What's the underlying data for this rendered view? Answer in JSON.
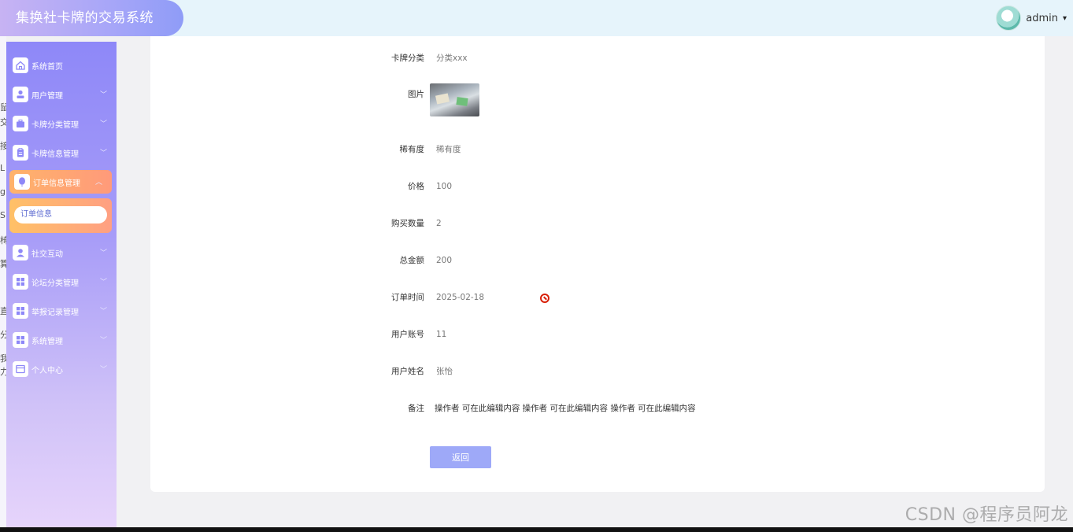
{
  "header": {
    "app_title": "集换社卡牌的交易系统",
    "user_name": "admin",
    "caret": "▾"
  },
  "edge_glyphs": [
    "鼠",
    "交",
    "接",
    "L",
    "g",
    "S",
    "椅",
    "算",
    "直",
    "分",
    "我",
    "力"
  ],
  "sidebar": {
    "items": [
      {
        "label": "系统首页",
        "icon": "home-icon",
        "has_chevron": false
      },
      {
        "label": "用户管理",
        "icon": "user-icon",
        "has_chevron": true
      },
      {
        "label": "卡牌分类管理",
        "icon": "briefcase-icon",
        "has_chevron": true
      },
      {
        "label": "卡牌信息管理",
        "icon": "clipboard-icon",
        "has_chevron": true
      },
      {
        "label": "订单信息管理",
        "icon": "balloon-icon",
        "has_chevron": true,
        "active": true
      },
      {
        "label": "社交互动",
        "icon": "person-icon",
        "has_chevron": true
      },
      {
        "label": "论坛分类管理",
        "icon": "grid-icon",
        "has_chevron": true
      },
      {
        "label": "举报记录管理",
        "icon": "grid-icon",
        "has_chevron": true
      },
      {
        "label": "系统管理",
        "icon": "grid-icon",
        "has_chevron": true
      },
      {
        "label": "个人中心",
        "icon": "card-icon",
        "has_chevron": true
      }
    ],
    "submenu": {
      "label": "订单信息"
    },
    "chevron_down": "﹀",
    "chevron_up": "︿"
  },
  "detail": {
    "fields": [
      {
        "label": "卡牌分类",
        "value": "分类xxx"
      },
      {
        "label": "图片",
        "value": ""
      },
      {
        "label": "稀有度",
        "value": "稀有度"
      },
      {
        "label": "价格",
        "value": "100"
      },
      {
        "label": "购买数量",
        "value": "2"
      },
      {
        "label": "总金额",
        "value": "200"
      },
      {
        "label": "订单时间",
        "value": "2025-02-18"
      },
      {
        "label": "用户账号",
        "value": "11"
      },
      {
        "label": "用户姓名",
        "value": "张怡"
      },
      {
        "label": "备注",
        "value": "操作者 可在此编辑内容 操作者 可在此编辑内容 操作者 可在此编辑内容"
      }
    ],
    "back_label": "返回"
  },
  "watermark": "CSDN @程序员阿龙",
  "colors": {
    "brand_gradient_start": "#c7b3f3",
    "sidebar_top": "#8e88f8",
    "active_item": "#ffb36b",
    "back_button": "#9ea9f8",
    "ban_icon": "#d81e06"
  }
}
